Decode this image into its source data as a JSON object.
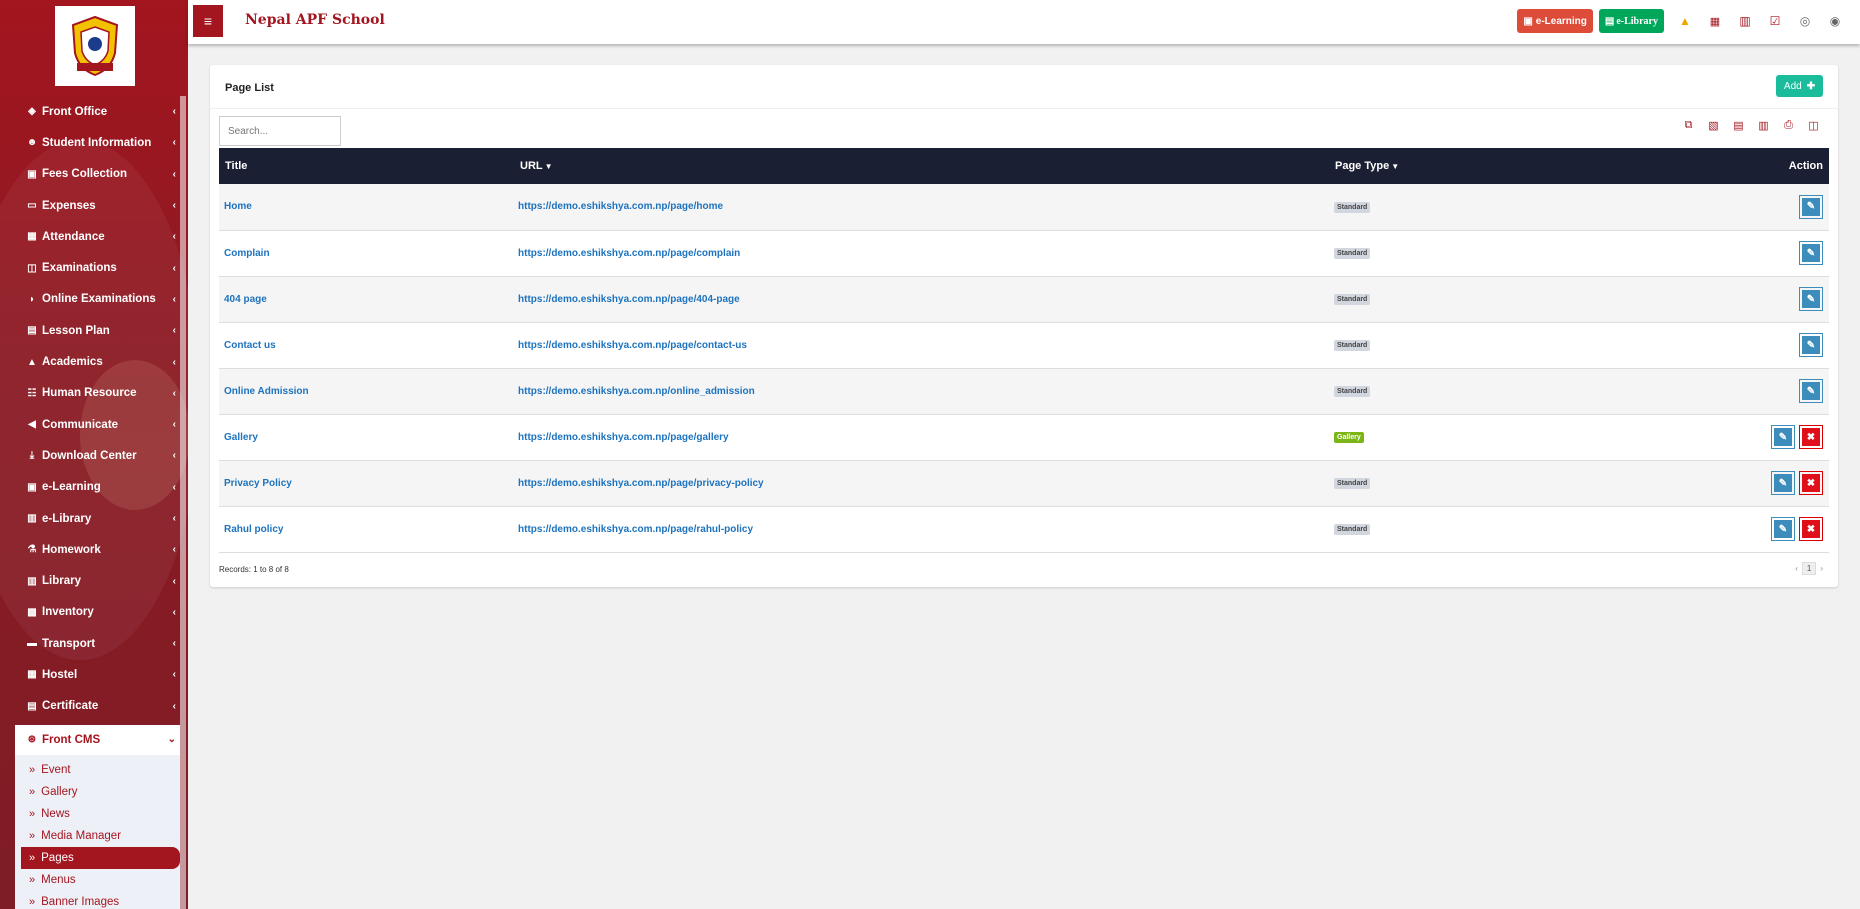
{
  "app": {
    "brand": "Nepal APF School"
  },
  "topbar": {
    "elearning_label": "e-Learning",
    "elibrary_label": "e-Library",
    "icons": [
      "bell-icon",
      "us-flag-icon",
      "calendar-icon",
      "check-square-icon",
      "whatsapp-icon",
      "user-circle-icon"
    ]
  },
  "sidebar": {
    "items": [
      {
        "label": "Front Office",
        "icon": "briefcase-icon"
      },
      {
        "label": "Student Information",
        "icon": "user-plus-icon"
      },
      {
        "label": "Fees Collection",
        "icon": "money-icon"
      },
      {
        "label": "Expenses",
        "icon": "credit-card-icon"
      },
      {
        "label": "Attendance",
        "icon": "calendar-check-icon"
      },
      {
        "label": "Examinations",
        "icon": "map-icon"
      },
      {
        "label": "Online Examinations",
        "icon": "rss-icon"
      },
      {
        "label": "Lesson Plan",
        "icon": "list-alt-icon"
      },
      {
        "label": "Academics",
        "icon": "mortar-board-icon"
      },
      {
        "label": "Human Resource",
        "icon": "sitemap-icon"
      },
      {
        "label": "Communicate",
        "icon": "bullhorn-icon"
      },
      {
        "label": "Download Center",
        "icon": "download-icon"
      },
      {
        "label": "e-Learning",
        "icon": "film-icon"
      },
      {
        "label": "e-Library",
        "icon": "book-icon"
      },
      {
        "label": "Homework",
        "icon": "flask-icon"
      },
      {
        "label": "Library",
        "icon": "book-icon"
      },
      {
        "label": "Inventory",
        "icon": "object-group-icon"
      },
      {
        "label": "Transport",
        "icon": "bus-icon"
      },
      {
        "label": "Hostel",
        "icon": "building-icon"
      },
      {
        "label": "Certificate",
        "icon": "newspaper-icon"
      }
    ],
    "active": {
      "label": "Front CMS",
      "icon": "empire-icon"
    },
    "submenu": [
      "Event",
      "Gallery",
      "News",
      "Media Manager",
      "Pages",
      "Menus",
      "Banner Images"
    ],
    "current_sub": "Pages"
  },
  "main": {
    "title": "Page List",
    "add_label": "Add",
    "search_placeholder": "Search...",
    "tools": [
      "copy-icon",
      "excel-icon",
      "csv-icon",
      "pdf-icon",
      "print-icon",
      "columns-icon"
    ],
    "columns": {
      "title": "Title",
      "url": "URL",
      "page_type": "Page Type",
      "action": "Action"
    },
    "rows": [
      {
        "title": "Home",
        "url": "https://demo.eshikshya.com.np/page/home",
        "type": "Standard",
        "deletable": false
      },
      {
        "title": "Complain",
        "url": "https://demo.eshikshya.com.np/page/complain",
        "type": "Standard",
        "deletable": false
      },
      {
        "title": "404 page",
        "url": "https://demo.eshikshya.com.np/page/404-page",
        "type": "Standard",
        "deletable": false
      },
      {
        "title": "Contact us",
        "url": "https://demo.eshikshya.com.np/page/contact-us",
        "type": "Standard",
        "deletable": false
      },
      {
        "title": "Online Admission",
        "url": "https://demo.eshikshya.com.np/online_admission",
        "type": "Standard",
        "deletable": false
      },
      {
        "title": "Gallery",
        "url": "https://demo.eshikshya.com.np/page/gallery",
        "type": "Gallery",
        "deletable": true
      },
      {
        "title": "Privacy Policy",
        "url": "https://demo.eshikshya.com.np/page/privacy-policy",
        "type": "Standard",
        "deletable": true
      },
      {
        "title": "Rahul policy",
        "url": "https://demo.eshikshya.com.np/page/rahul-policy",
        "type": "Standard",
        "deletable": true
      }
    ],
    "records": "Records: 1 to 8 of 8",
    "page": "1",
    "colors": {
      "brand": "#a3151f",
      "header": "#1b1f33",
      "link": "#1e73be",
      "add": "#1abc9c"
    }
  }
}
